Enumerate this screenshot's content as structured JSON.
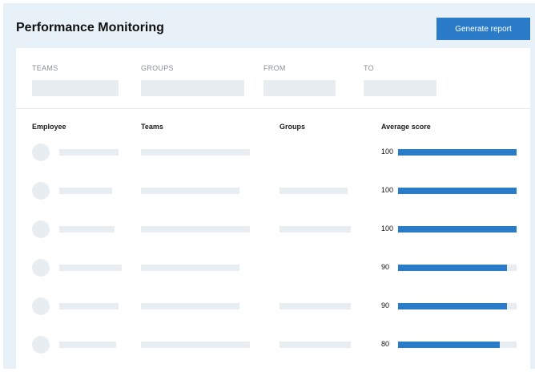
{
  "header": {
    "title": "Performance Monitoring",
    "generate_button": "Generate report"
  },
  "filters": [
    {
      "label": "TEAMS"
    },
    {
      "label": "GROUPS"
    },
    {
      "label": "FROM"
    },
    {
      "label": "TO"
    }
  ],
  "table": {
    "columns": [
      "Employee",
      "Teams",
      "Groups",
      "Average score"
    ],
    "rows": [
      {
        "score": "100",
        "score_fraction": 1.0
      },
      {
        "score": "100",
        "score_fraction": 1.0
      },
      {
        "score": "100",
        "score_fraction": 1.0
      },
      {
        "score": "90",
        "score_fraction": 0.92
      },
      {
        "score": "90",
        "score_fraction": 0.92
      },
      {
        "score": "80",
        "score_fraction": 0.86
      }
    ]
  },
  "colors": {
    "accent": "#2a7cc9",
    "background": "#e8f0f8",
    "placeholder": "#e8edf2"
  }
}
